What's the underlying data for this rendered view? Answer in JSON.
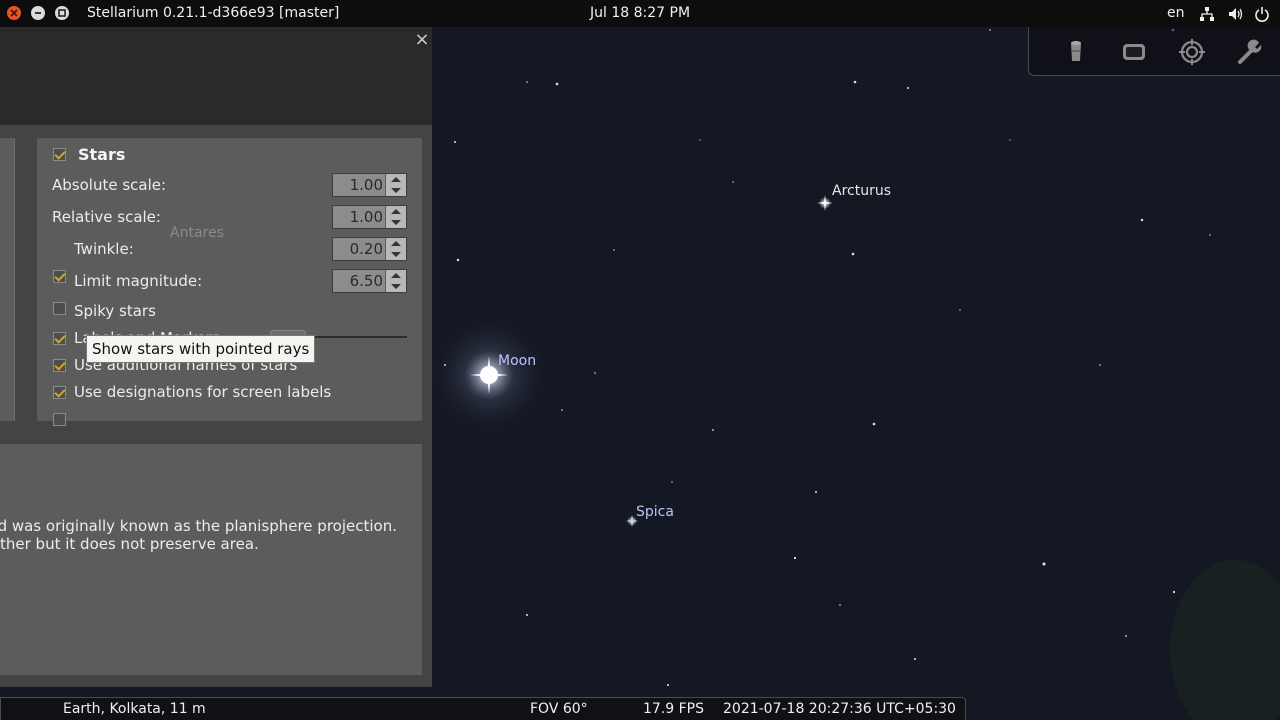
{
  "window": {
    "title": "Stellarium 0.21.1-d366e93 [master]",
    "clock": "Jul 18  8:27 PM",
    "language": "en",
    "tray_icons": [
      "network-icon",
      "volume-icon",
      "power-icon"
    ]
  },
  "toolbar": {
    "buttons": [
      "ocular-icon",
      "screen-icon",
      "target-icon",
      "wrench-icon"
    ]
  },
  "dialog": {
    "close_glyph": "×",
    "stars": {
      "title": "Stars",
      "enabled": true,
      "absolute_scale_label": "Absolute scale:",
      "absolute_scale_value": "1.00",
      "relative_scale_label": "Relative scale:",
      "relative_scale_value": "1.00",
      "twinkle_label": "Twinkle:",
      "twinkle_checked": true,
      "twinkle_value": "0.20",
      "limit_magnitude_label": "Limit magnitude:",
      "limit_magnitude_checked": false,
      "limit_magnitude_value": "6.50",
      "spiky_label": "Spiky stars",
      "spiky_checked": true,
      "labels_label": "Labels and Markers",
      "labels_checked": true,
      "additional_names_label": "Use additional names of stars",
      "additional_names_checked": true,
      "designations_label": "Use designations for screen labels",
      "designations_checked": false
    },
    "tooltip": "Show stars with pointed rays",
    "projection_text": [
      "d was originally known as the planisphere projection.",
      "ther but it does not preserve area."
    ]
  },
  "sky": {
    "labels": {
      "arcturus": "Arcturus",
      "moon": "Moon",
      "spica": "Spica",
      "antares": "Antares"
    },
    "colors": {
      "arcturus": "#e6e6e6",
      "moon": "#b9c3ff",
      "spica": "#b9c3ff",
      "antares": "#8a8a8a"
    }
  },
  "statusbar": {
    "location": "Earth, Kolkata, 11 m",
    "fov": "FOV 60°",
    "fps": "17.9 FPS",
    "datetime": "2021-07-18 20:27:36 UTC+05:30"
  }
}
